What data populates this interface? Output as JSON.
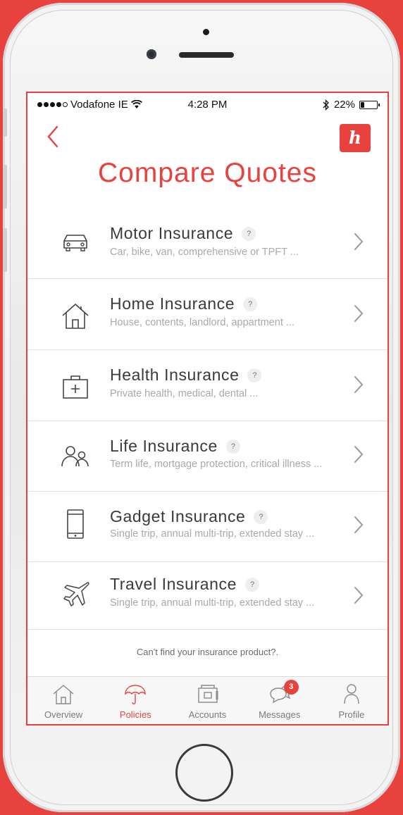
{
  "status_bar": {
    "carrier": "Vodafone IE",
    "time": "4:28 PM",
    "battery": "22%",
    "battery_level": 0.22,
    "icons": [
      "signal-dots-icon",
      "wifi-icon",
      "bluetooth-icon",
      "battery-icon"
    ]
  },
  "header": {
    "back_icon": "chevron-left-icon",
    "brand_badge": "h",
    "title": "Compare Quotes"
  },
  "insurance_items": [
    {
      "title": "Motor Insurance",
      "subtitle": "Car, bike, van, comprehensive or TPFT ...",
      "icon": "car-icon",
      "help": "?"
    },
    {
      "title": "Home Insurance",
      "subtitle": "House, contents, landlord, appartment ...",
      "icon": "house-icon",
      "help": "?"
    },
    {
      "title": "Health Insurance",
      "subtitle": "Private health, medical, dental ...",
      "icon": "medical-kit-icon",
      "help": "?"
    },
    {
      "title": "Life Insurance",
      "subtitle": "Term life, mortgage protection, critical illness ...",
      "icon": "people-icon",
      "help": "?"
    },
    {
      "title": "Gadget Insurance",
      "subtitle": "Single trip, annual multi-trip, extended stay ...",
      "icon": "phone-icon",
      "help": "?"
    },
    {
      "title": "Travel Insurance",
      "subtitle": "Single trip, annual multi-trip, extended stay ...",
      "icon": "airplane-icon",
      "help": "?"
    }
  ],
  "footer_note": "Can't find your insurance product?.",
  "tab_bar": {
    "active": "Policies",
    "tabs": [
      {
        "label": "Overview",
        "icon": "house-icon"
      },
      {
        "label": "Policies",
        "icon": "umbrella-icon"
      },
      {
        "label": "Accounts",
        "icon": "wallet-icon"
      },
      {
        "label": "Messages",
        "icon": "chat-bubbles-icon",
        "badge": "3"
      },
      {
        "label": "Profile",
        "icon": "person-icon"
      }
    ]
  },
  "colors": {
    "accent": "#e8423f",
    "text_primary": "#3a3a3a",
    "text_secondary": "#a9a9a9",
    "tab_inactive": "#7a7a7a"
  }
}
